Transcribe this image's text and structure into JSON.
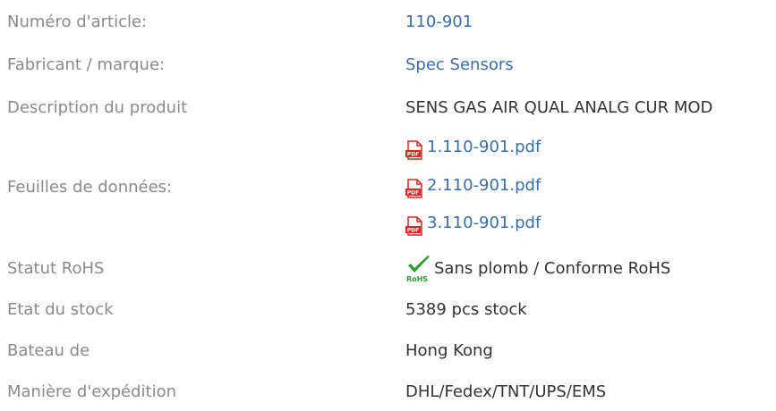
{
  "rows": {
    "article": {
      "label": "Numéro d'article:",
      "value": "110-901"
    },
    "manufacturer": {
      "label": "Fabricant / marque:",
      "value": "Spec Sensors"
    },
    "description": {
      "label": "Description du produit",
      "value": "SENS GAS AIR QUAL ANALG CUR MOD"
    },
    "datasheets": {
      "label": "Feuilles de données:",
      "files": [
        "1.110-901.pdf",
        "2.110-901.pdf",
        "3.110-901.pdf"
      ],
      "icon": "pdf-icon",
      "icon_text": "PDF"
    },
    "rohs": {
      "label": "Statut RoHS",
      "value": "Sans plomb / Conforme RoHS",
      "icon": "rohs-check-icon",
      "icon_text": "RoHS"
    },
    "stock": {
      "label": "Etat du stock",
      "value": "5389 pcs stock"
    },
    "ship_from": {
      "label": "Bateau de",
      "value": "Hong Kong"
    },
    "shipping": {
      "label": "Manière d'expédition",
      "value": "DHL/Fedex/TNT/UPS/EMS"
    }
  },
  "colors": {
    "label": "#8a8a8a",
    "link": "#3a6ea5",
    "value": "#333333",
    "pdf_red": "#d7261e",
    "rohs_green": "#2f9e2f"
  }
}
